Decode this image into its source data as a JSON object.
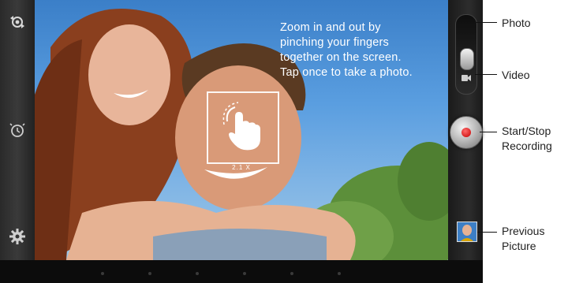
{
  "hint": {
    "lines": [
      "Zoom in and out by",
      "pinching your fingers",
      "together on the screen.",
      "Tap once to take a photo."
    ]
  },
  "zoom_level": "2.1 X",
  "callouts": {
    "photo": "Photo",
    "video": "Video",
    "start_stop_line1": "Start/Stop",
    "start_stop_line2": "Recording",
    "previous_line1": "Previous",
    "previous_line2": "Picture"
  },
  "icons": {
    "left": [
      "camera-switch-icon",
      "timer-icon",
      "settings-gear-icon"
    ],
    "right": [
      "photo-mode-icon",
      "video-mode-icon",
      "record-button-icon",
      "previous-picture-thumbnail"
    ],
    "overlay": "tap-gesture-icon"
  },
  "colors": {
    "record_red": "#d40000",
    "hint_text": "#ffffff",
    "frame": "#1b1b1b"
  }
}
